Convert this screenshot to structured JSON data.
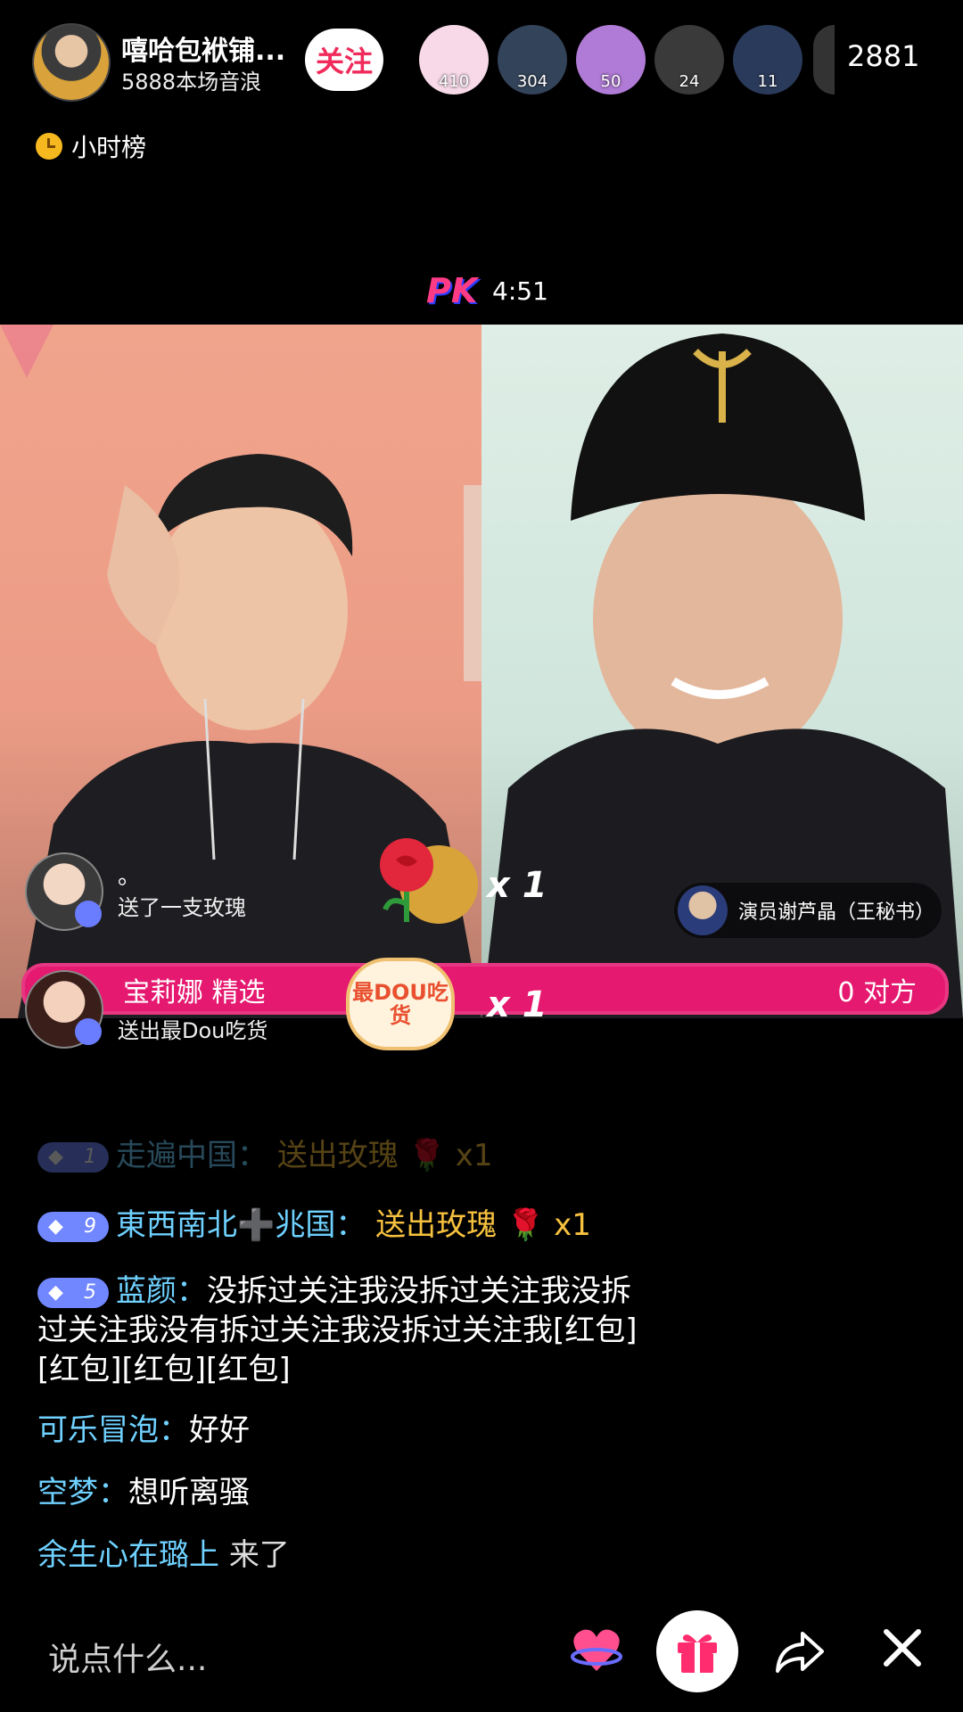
{
  "header": {
    "host_name": "嘻哈包袱铺...",
    "host_sub": "5888本场音浪",
    "follow_label": "关注",
    "viewers": [
      {
        "count": "410",
        "color": "#f7d9e8"
      },
      {
        "count": "304",
        "color": "#33445a"
      },
      {
        "count": "50",
        "color": "#b07bd6"
      },
      {
        "count": "24",
        "color": "#3a3a3a"
      },
      {
        "count": "11",
        "color": "#2a3a5a"
      }
    ],
    "viewer_total": "2881"
  },
  "rank": {
    "label": "小时榜"
  },
  "pk": {
    "logo": "PK",
    "timer": "4:51"
  },
  "gifts": [
    {
      "user": "。",
      "action": "送了一支玫瑰",
      "multiplier": "x 1",
      "gift_icon": "rose-microphone-icon"
    },
    {
      "user": "宝莉娜 精选",
      "action": "送出最Dou吃货",
      "multiplier": "x 1",
      "gift_icon": "dou-chihuo-icon",
      "gift_text": "最DOU吃货"
    }
  ],
  "opponent": {
    "name": "演员谢芦晶（王秘书）"
  },
  "pk_bar": {
    "left_label": "宝莉娜   精选",
    "right_label": "0 对方"
  },
  "chat": [
    {
      "level": "1",
      "user": "走遍中国：",
      "text": "送出玫瑰 🌹 x1",
      "type": "gift",
      "faded": true
    },
    {
      "level": "9",
      "user": "東西南北➕兆国：",
      "text": "送出玫瑰 🌹 x1",
      "type": "gift"
    },
    {
      "level": "5",
      "user": "蓝颜：",
      "text": "没拆过关注我没拆过关注我没拆",
      "type": "msg",
      "more": [
        "过关注我没有拆过关注我没拆过关注我[红包]",
        "[红包][红包][红包]"
      ]
    },
    {
      "user": "可乐冒泡：",
      "text": "好好",
      "type": "msg"
    },
    {
      "user": "空梦：",
      "text": "想听离骚",
      "type": "msg"
    },
    {
      "user": "余生心在璐上",
      "text": "来了",
      "type": "join"
    }
  ],
  "bottom": {
    "input_placeholder": "说点什么..."
  },
  "colors": {
    "accent": "#e5196f",
    "username": "#6fd1ff",
    "gift_text": "#f6c13e",
    "level_badge": "#7087ff"
  }
}
